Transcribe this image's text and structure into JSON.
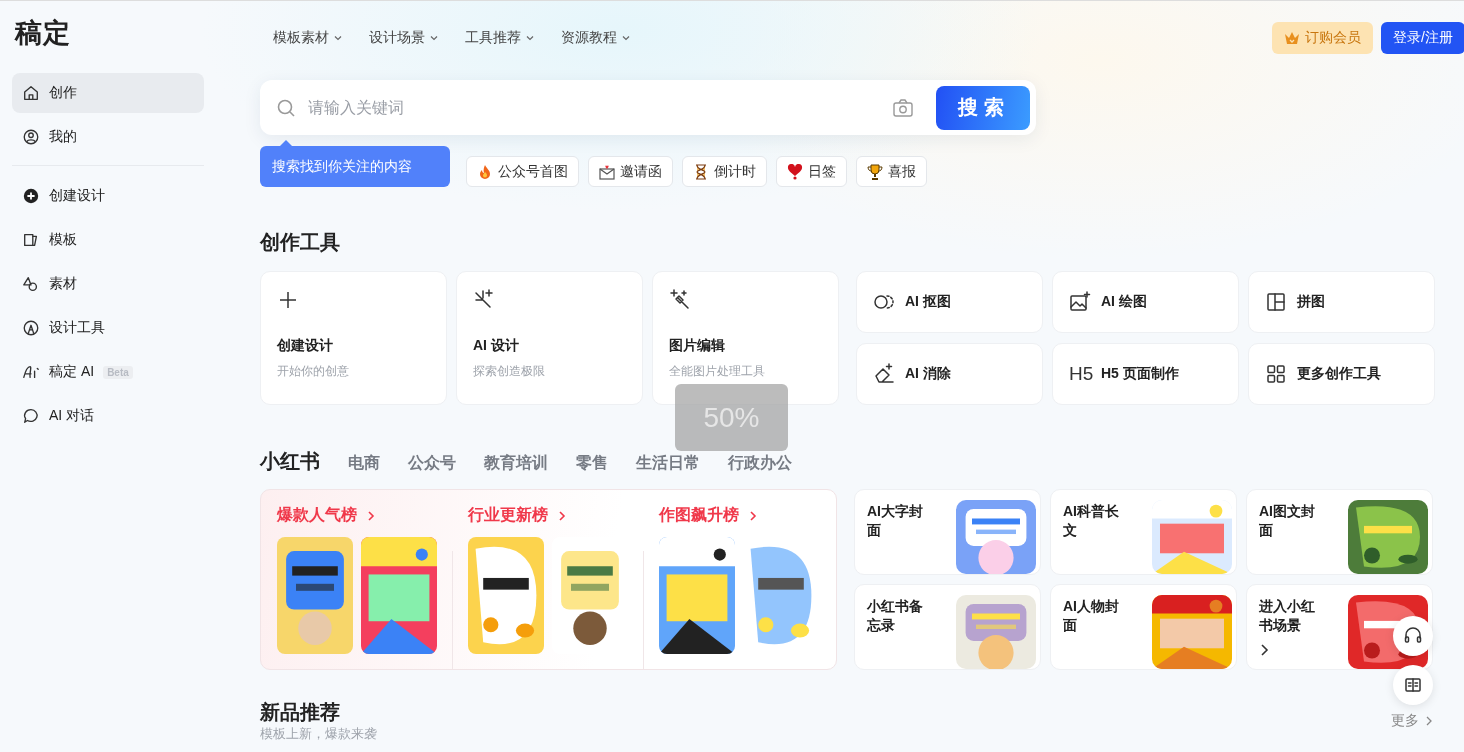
{
  "logo": "稿定",
  "sidebar": {
    "groups": [
      [
        {
          "label": "创作",
          "selected": true
        },
        {
          "label": "我的",
          "selected": false
        }
      ],
      [
        {
          "label": "创建设计",
          "selected": false
        },
        {
          "label": "模板",
          "selected": false
        },
        {
          "label": "素材",
          "selected": false
        },
        {
          "label": "设计工具",
          "selected": false
        },
        {
          "label": "稿定 AI",
          "badge": "Beta",
          "selected": false
        },
        {
          "label": "AI 对话",
          "selected": false
        }
      ]
    ]
  },
  "nav": [
    {
      "label": "模板素材"
    },
    {
      "label": "设计场景"
    },
    {
      "label": "工具推荐"
    },
    {
      "label": "资源教程"
    }
  ],
  "header_buttons": [
    {
      "label": "订购会员",
      "kind": "vip"
    },
    {
      "label": "登录/注册",
      "kind": "primary"
    }
  ],
  "search": {
    "placeholder": "请输入关键词",
    "button": "搜索",
    "tooltip": "搜索找到你关注的内容"
  },
  "chips": [
    {
      "label": "公众号首图"
    },
    {
      "label": "邀请函"
    },
    {
      "label": "倒计时"
    },
    {
      "label": "日签"
    },
    {
      "label": "喜报"
    }
  ],
  "tools": {
    "title": "创作工具",
    "big_cards": [
      {
        "title": "创建设计",
        "subtitle": "开始你的创意"
      },
      {
        "title": "AI 设计",
        "subtitle": "探索创造极限"
      },
      {
        "title": "图片编辑",
        "subtitle": "全能图片处理工具"
      }
    ],
    "small_cards": [
      {
        "title": "AI 抠图"
      },
      {
        "title": "AI 绘图"
      },
      {
        "title": "拼图"
      },
      {
        "title": "AI 消除"
      },
      {
        "title": "H5 页面制作",
        "glyph": "H5"
      },
      {
        "title": "更多创作工具"
      }
    ]
  },
  "scenes": {
    "tabs": [
      {
        "label": "小红书",
        "selected": true
      },
      {
        "label": "电商",
        "selected": false
      },
      {
        "label": "公众号",
        "selected": false
      },
      {
        "label": "教育培训",
        "selected": false
      },
      {
        "label": "零售",
        "selected": false
      },
      {
        "label": "生活日常",
        "selected": false
      },
      {
        "label": "行政办公",
        "selected": false
      }
    ],
    "rankings": [
      {
        "title": "爆款人气榜"
      },
      {
        "title": "行业更新榜"
      },
      {
        "title": "作图飙升榜"
      }
    ],
    "feature_cards": [
      {
        "title": "AI大字封面"
      },
      {
        "title": "AI科普长文"
      },
      {
        "title": "AI图文封面"
      },
      {
        "title": "小红书备忘录"
      },
      {
        "title": "AI人物封面"
      },
      {
        "title": "进入小红书场景",
        "arrow": true
      }
    ]
  },
  "new_section": {
    "title": "新品推荐",
    "subtitle": "模板上新，爆款来袭",
    "more": "更多"
  },
  "zoom_overlay": "50%"
}
